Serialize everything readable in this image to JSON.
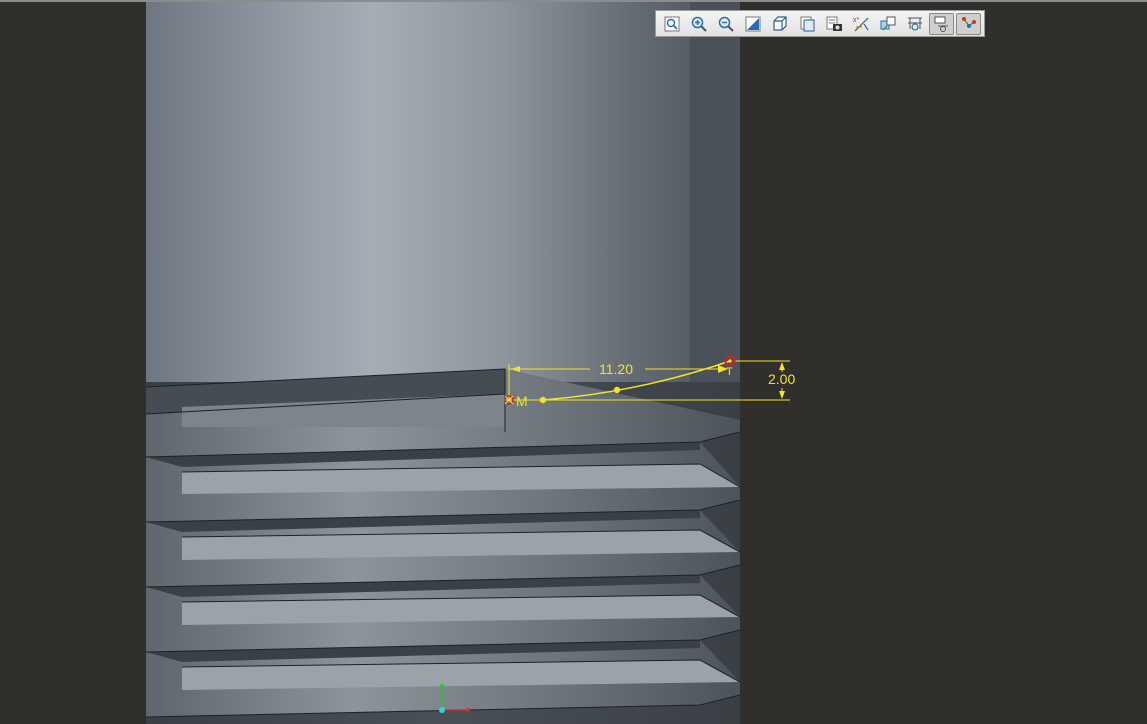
{
  "toolbar": {
    "buttons": [
      {
        "name": "refit-icon",
        "active": false
      },
      {
        "name": "zoom-in-icon",
        "active": false
      },
      {
        "name": "zoom-out-icon",
        "active": false
      },
      {
        "name": "repaint-icon",
        "active": false
      },
      {
        "name": "display-style-icon",
        "active": false
      },
      {
        "name": "saved-orientations-icon",
        "active": false
      },
      {
        "name": "view-manager-icon",
        "active": false
      },
      {
        "name": "datum-display-icon",
        "active": false
      },
      {
        "name": "annotation-display-icon",
        "active": false
      },
      {
        "name": "sketch-display-icon",
        "active": false
      },
      {
        "name": "sketcher-display-icon",
        "active": true
      },
      {
        "name": "constraint-display-icon",
        "active": true
      }
    ]
  },
  "sketch": {
    "horizontal_dimension": "11.20",
    "vertical_dimension": "2.00",
    "constraint_label": "M",
    "tangent_label": "T"
  },
  "colors": {
    "background": "#312f2c",
    "sketch_yellow": "#f2e22a",
    "endpoint_red": "#d42020"
  }
}
